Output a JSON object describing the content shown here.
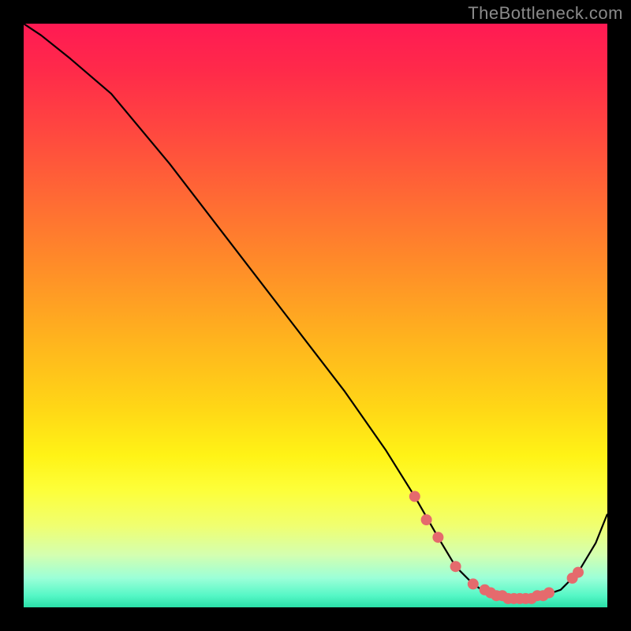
{
  "watermark": "TheBottleneck.com",
  "chart_data": {
    "type": "line",
    "title": "",
    "xlabel": "",
    "ylabel": "",
    "xlim": [
      0,
      100
    ],
    "ylim": [
      0,
      100
    ],
    "grid": false,
    "series": [
      {
        "name": "curve",
        "x": [
          0,
          3,
          8,
          15,
          25,
          35,
          45,
          55,
          62,
          67,
          71,
          74,
          77,
          80,
          83,
          86,
          89,
          92,
          95,
          98,
          100
        ],
        "y": [
          100,
          98,
          94,
          88,
          76,
          63,
          50,
          37,
          27,
          19,
          12,
          7,
          4,
          2,
          1,
          1,
          2,
          3,
          6,
          11,
          16
        ]
      }
    ],
    "markers": [
      {
        "x": 67,
        "y": 19
      },
      {
        "x": 69,
        "y": 15
      },
      {
        "x": 71,
        "y": 12
      },
      {
        "x": 74,
        "y": 7
      },
      {
        "x": 77,
        "y": 4
      },
      {
        "x": 79,
        "y": 3
      },
      {
        "x": 80,
        "y": 2.5
      },
      {
        "x": 81,
        "y": 2
      },
      {
        "x": 82,
        "y": 2
      },
      {
        "x": 83,
        "y": 1.5
      },
      {
        "x": 84,
        "y": 1.5
      },
      {
        "x": 85,
        "y": 1.5
      },
      {
        "x": 86,
        "y": 1.5
      },
      {
        "x": 87,
        "y": 1.5
      },
      {
        "x": 88,
        "y": 2
      },
      {
        "x": 89,
        "y": 2
      },
      {
        "x": 90,
        "y": 2.5
      },
      {
        "x": 94,
        "y": 5
      },
      {
        "x": 95,
        "y": 6
      }
    ],
    "marker_color": "#e56a6d",
    "note": "y is approximate distance-from-optimum percentage read from vertical gradient; x is horizontal position percentage. Values estimated from pixel positions."
  }
}
